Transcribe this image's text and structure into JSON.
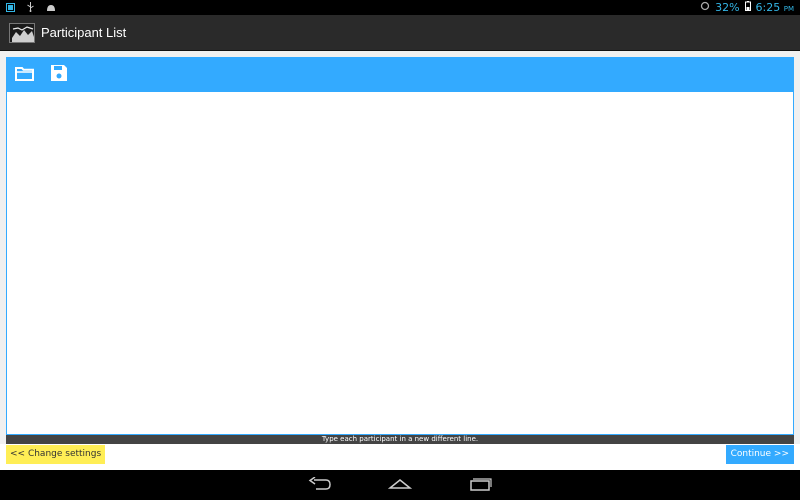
{
  "status_bar": {
    "battery_percent": "32%",
    "time": "6:25",
    "ampm": "PM",
    "left_icons": [
      "notification-icon",
      "usb-icon",
      "android-debug-icon"
    ],
    "right_icons": [
      "sync-icon",
      "battery-icon"
    ]
  },
  "action_bar": {
    "title": "Participant List",
    "app_icon": "app-logo-icon"
  },
  "toolbar": {
    "buttons": [
      "folder-open-icon",
      "save-icon"
    ]
  },
  "editor": {
    "value": "",
    "placeholder": ""
  },
  "hint": "Type each participant in a new different line.",
  "buttons": {
    "change_settings": "<< Change settings",
    "continue": "Continue >>"
  },
  "navigation": {
    "buttons": [
      "back-icon",
      "home-icon",
      "recent-apps-icon"
    ]
  },
  "colors": {
    "accent": "#33aaff",
    "highlight": "#ffee55",
    "status_text": "#33b5e5"
  }
}
